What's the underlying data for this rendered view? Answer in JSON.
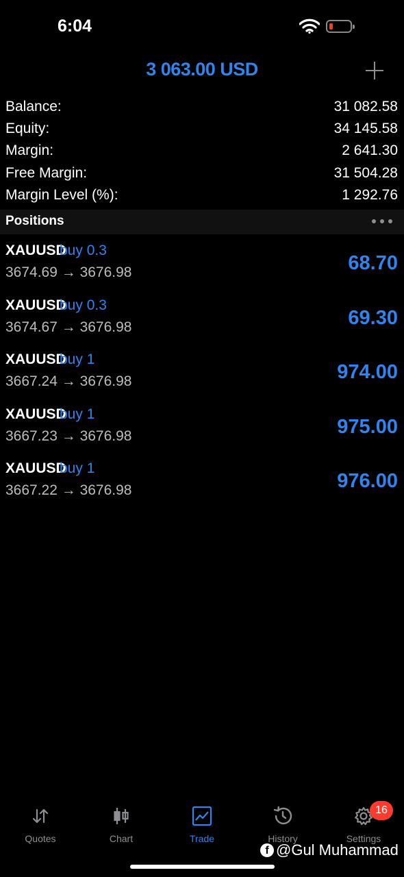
{
  "status_bar": {
    "time": "6:04"
  },
  "header": {
    "title": "3 063.00 USD"
  },
  "account": [
    {
      "label": "Balance:",
      "value": "31 082.58"
    },
    {
      "label": "Equity:",
      "value": "34 145.58"
    },
    {
      "label": "Margin:",
      "value": "2 641.30"
    },
    {
      "label": "Free Margin:",
      "value": "31 504.28"
    },
    {
      "label": "Margin Level (%):",
      "value": "1 292.76"
    }
  ],
  "positions": {
    "title": "Positions",
    "items": [
      {
        "symbol": "XAUUSD",
        "side": "buy 0.3",
        "prices": "3674.69 → 3676.98",
        "profit": "68.70"
      },
      {
        "symbol": "XAUUSD",
        "side": "buy 0.3",
        "prices": "3674.67 → 3676.98",
        "profit": "69.30"
      },
      {
        "symbol": "XAUUSD",
        "side": "buy 1",
        "prices": "3667.24 → 3676.98",
        "profit": "974.00"
      },
      {
        "symbol": "XAUUSD",
        "side": "buy 1",
        "prices": "3667.23 → 3676.98",
        "profit": "975.00"
      },
      {
        "symbol": "XAUUSD",
        "side": "buy 1",
        "prices": "3667.22 → 3676.98",
        "profit": "976.00"
      }
    ]
  },
  "tabs": [
    {
      "label": "Quotes",
      "icon": "quotes-icon"
    },
    {
      "label": "Chart",
      "icon": "candlestick-icon"
    },
    {
      "label": "Trade",
      "icon": "trade-icon",
      "active": true
    },
    {
      "label": "History",
      "icon": "history-icon"
    },
    {
      "label": "Settings",
      "icon": "gear-icon",
      "badge": "16"
    }
  ],
  "watermark": {
    "text": "@Gul Muhammad"
  },
  "colors": {
    "accent": "#2f84ee",
    "badge": "#ff3b30",
    "background": "#000000"
  }
}
